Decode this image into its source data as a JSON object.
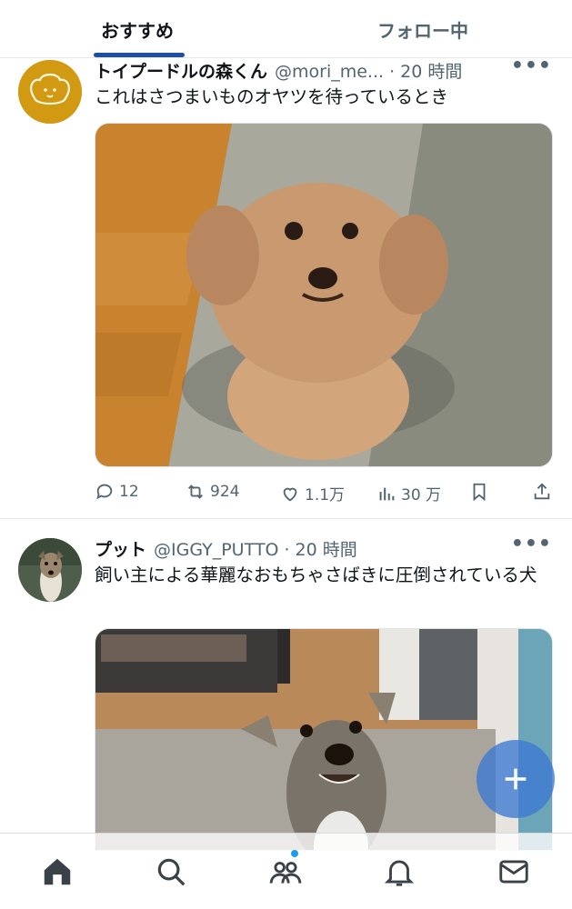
{
  "tabs": [
    {
      "label": "おすすめ",
      "active": true
    },
    {
      "label": "フォロー中",
      "active": false
    }
  ],
  "tweets": [
    {
      "name": "トイプードルの森くん",
      "handle": "@mori_me... · 20 時間",
      "text": "これはさつまいものオヤツを待っているとき",
      "actions": {
        "replies": "12",
        "retweets": "924",
        "likes": "1.1万",
        "views": "30 万"
      }
    },
    {
      "name": "プット",
      "handle": "@IGGY_PUTTO · 20 時間",
      "text": "飼い主による華麗なおもちゃさばきに圧倒されている犬"
    }
  ],
  "icons": {
    "more": "more-icon",
    "reply": "reply-icon",
    "retweet": "retweet-icon",
    "like": "heart-icon",
    "views": "views-icon",
    "bookmark": "bookmark-icon",
    "share": "share-icon",
    "compose": "plus-icon",
    "home": "home-icon",
    "search": "search-icon",
    "communities": "communities-icon",
    "notifications": "bell-icon",
    "messages": "mail-icon"
  },
  "colors": {
    "accent": "#1d9bf0",
    "tab_underline": "#1d4ea3",
    "text_secondary": "#536471"
  }
}
